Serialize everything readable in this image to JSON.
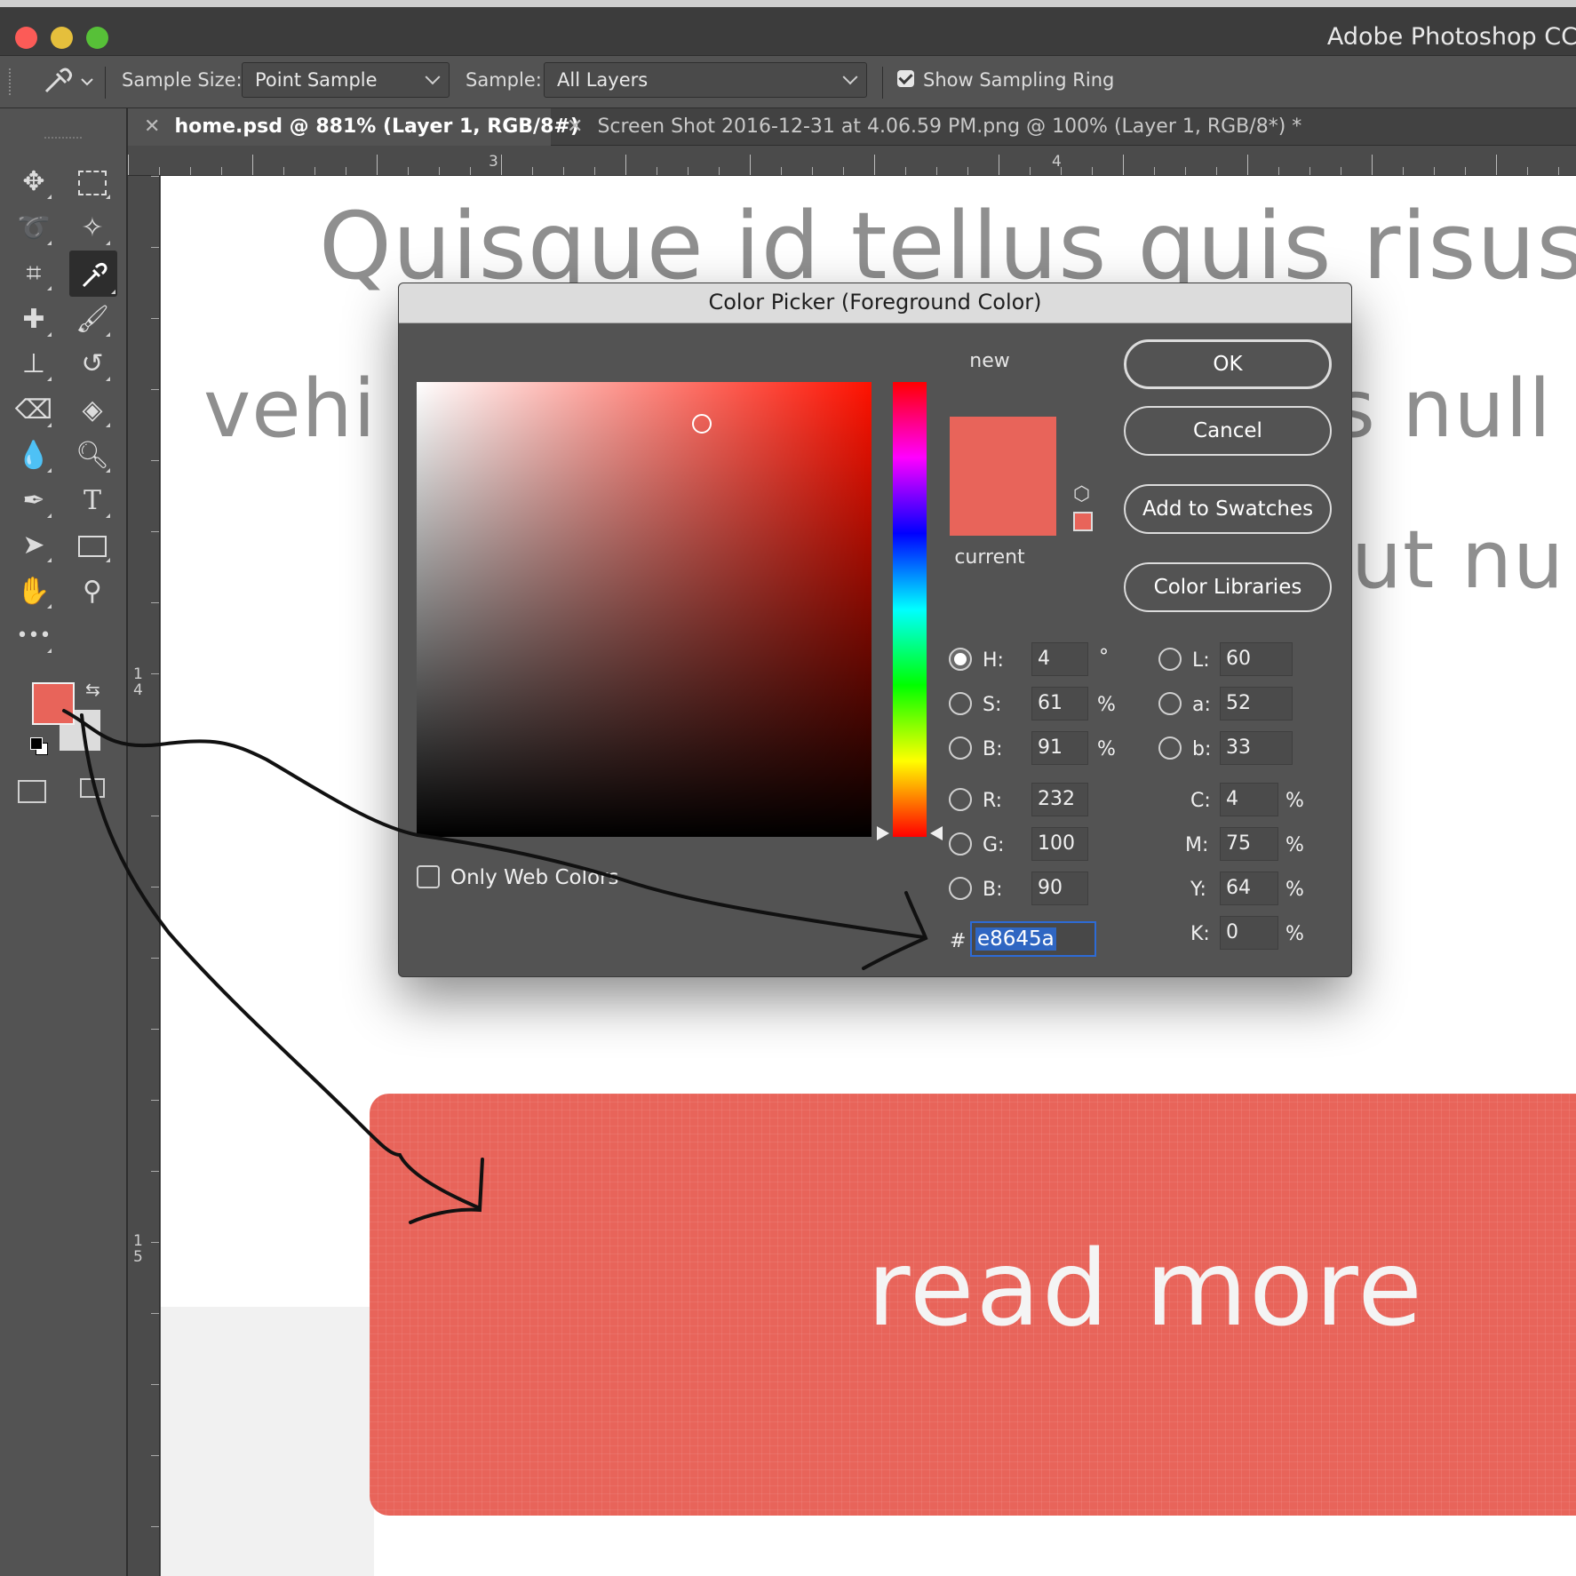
{
  "app": {
    "title": "Adobe Photoshop CC"
  },
  "options_bar": {
    "sample_size_label": "Sample Size:",
    "sample_size_value": "Point Sample",
    "sample_label": "Sample:",
    "sample_value": "All Layers",
    "sampling_ring_label": "Show Sampling Ring",
    "sampling_ring_checked": true
  },
  "tabs": [
    {
      "label": "home.psd @ 881% (Layer 1, RGB/8#)",
      "active": true
    },
    {
      "label": "Screen Shot 2016-12-31 at 4.06.59 PM.png @ 100% (Layer 1, RGB/8*) *",
      "active": false
    }
  ],
  "rulers": {
    "top": [
      "3",
      "4"
    ],
    "left": [
      "1\n4",
      "1\n5"
    ]
  },
  "canvas": {
    "line1": "Quisque id tellus quis risus ",
    "line2_left": "vehi",
    "line2_right": "s null",
    "line3_right": "ut nu",
    "button_text": "read more"
  },
  "colors": {
    "foreground": "#e8645a",
    "background": "#dcdcdc",
    "accent": "#2f66c2"
  },
  "color_picker": {
    "title": "Color Picker (Foreground Color)",
    "new_label": "new",
    "current_label": "current",
    "buttons": {
      "ok": "OK",
      "cancel": "Cancel",
      "add_to_swatches": "Add to Swatches",
      "color_libraries": "Color Libraries"
    },
    "only_web_colors": "Only Web Colors",
    "only_web_colors_checked": false,
    "hsb": {
      "h_label": "H:",
      "h": "4",
      "h_unit": "°",
      "s_label": "S:",
      "s": "61",
      "s_unit": "%",
      "b_label": "B:",
      "b": "91",
      "b_unit": "%"
    },
    "rgb": {
      "r_label": "R:",
      "r": "232",
      "g_label": "G:",
      "g": "100",
      "b_label": "B:",
      "b": "90"
    },
    "lab": {
      "l_label": "L:",
      "l": "60",
      "a_label": "a:",
      "a": "52",
      "b_label": "b:",
      "b": "33"
    },
    "cmyk": {
      "c_label": "C:",
      "c": "4",
      "m_label": "M:",
      "m": "75",
      "y_label": "Y:",
      "y": "64",
      "k_label": "K:",
      "k": "0",
      "unit": "%"
    },
    "hex_label": "#",
    "hex": "e8645a",
    "selected_mode": "H"
  }
}
